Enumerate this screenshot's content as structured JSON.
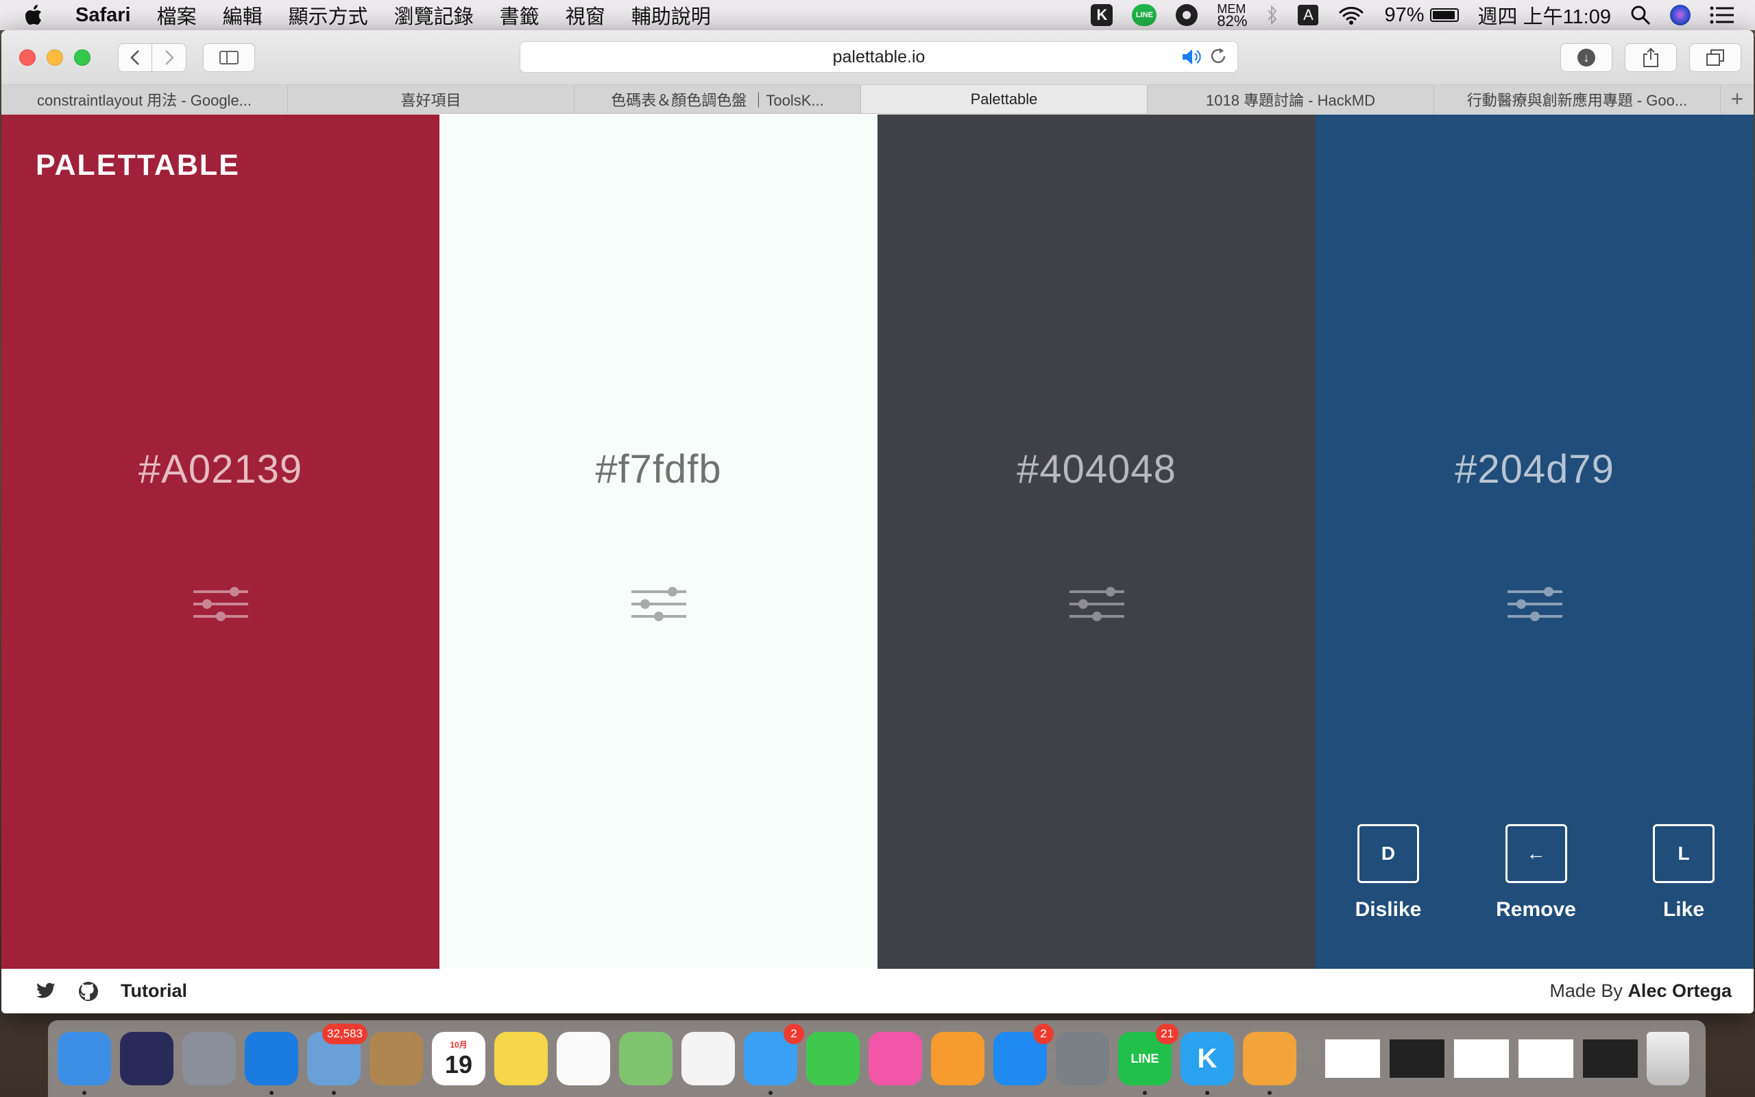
{
  "menubar": {
    "app_name": "Safari",
    "menus": [
      "檔案",
      "編輯",
      "顯示方式",
      "瀏覽記錄",
      "書籤",
      "視窗",
      "輔助說明"
    ],
    "status": {
      "k_icon_label": "K",
      "line_label": "LINE",
      "mem_label": "MEM",
      "mem_value": "82%",
      "input_label": "A",
      "battery": "97%",
      "battery_level": 0.97,
      "clock": "週四 上午11:09"
    }
  },
  "browser": {
    "url": "palettable.io",
    "tabs": [
      {
        "title": "constraintlayout 用法 - Google...",
        "active": false
      },
      {
        "title": "喜好項目",
        "active": false
      },
      {
        "title": "色碼表＆顏色調色盤 ｜ToolsK...",
        "active": false
      },
      {
        "title": "Palettable",
        "active": true
      },
      {
        "title": "1018 專題討論 - HackMD",
        "active": false
      },
      {
        "title": "行動醫療與創新應用專題 - Goo...",
        "active": false
      }
    ],
    "new_tab_glyph": "+"
  },
  "page": {
    "brand": "PALETTABLE",
    "palette": [
      {
        "hex": "#A02139",
        "color": "#A02139",
        "text_color": "#e6bcc3",
        "icon_color": "#c98595"
      },
      {
        "hex": "#f7fdfb",
        "color": "#f7fdfb",
        "text_color": "#6f7370",
        "icon_color": "#a9abaa"
      },
      {
        "hex": "#404048",
        "color": "#404048",
        "text_color": "#b8b8bc",
        "icon_color": "#8c8c92"
      },
      {
        "hex": "#204d79",
        "color": "#204d79",
        "text_color": "#b7c4d2",
        "icon_color": "#8a9fb6"
      }
    ],
    "actions": [
      {
        "key": "D",
        "label": "Dislike"
      },
      {
        "key": "←",
        "label": "Remove"
      },
      {
        "key": "L",
        "label": "Like"
      }
    ],
    "footer": {
      "tutorial": "Tutorial",
      "made_by_prefix": "Made By",
      "author": "Alec Ortega"
    }
  },
  "dock": {
    "apps": [
      {
        "name": "finder",
        "color": "#3d8fe6",
        "running": true
      },
      {
        "name": "siri",
        "color": "#2a2a5a"
      },
      {
        "name": "launchpad",
        "color": "#8a8f99"
      },
      {
        "name": "safari",
        "color": "#1a7ce0",
        "running": true
      },
      {
        "name": "mail",
        "color": "#6aa0d8",
        "badge": "32,583",
        "running": true
      },
      {
        "name": "contacts",
        "color": "#b08650"
      },
      {
        "name": "calendar",
        "color": "#ffffff",
        "label": "19",
        "month": "10月"
      },
      {
        "name": "notes",
        "color": "#f6d64a"
      },
      {
        "name": "reminders",
        "color": "#fafafa"
      },
      {
        "name": "maps",
        "color": "#7fc36e"
      },
      {
        "name": "photos",
        "color": "#f4f4f4"
      },
      {
        "name": "messages",
        "color": "#3aa0f5",
        "badge": "2",
        "running": true
      },
      {
        "name": "facetime",
        "color": "#3ec94c"
      },
      {
        "name": "itunes",
        "color": "#f056a5"
      },
      {
        "name": "ibooks",
        "color": "#f79b2e"
      },
      {
        "name": "app-store",
        "color": "#1e8af2",
        "badge": "2"
      },
      {
        "name": "system-preferences",
        "color": "#7b7f86"
      },
      {
        "name": "line",
        "color": "#20c04a",
        "badge": "21",
        "running": true,
        "label": "LINE"
      },
      {
        "name": "k-app",
        "color": "#2aa2f0",
        "running": true,
        "label": "K"
      },
      {
        "name": "pages",
        "color": "#f2a33a",
        "running": true
      }
    ],
    "thumbs": [
      "light",
      "dark",
      "light",
      "light",
      "dark"
    ]
  }
}
